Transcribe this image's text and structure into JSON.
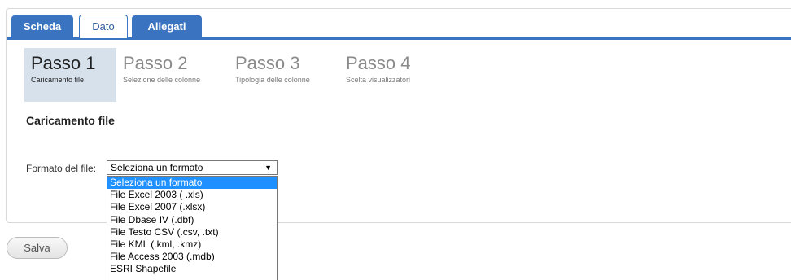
{
  "tabs": [
    {
      "label": "Scheda",
      "active": false
    },
    {
      "label": "Dato",
      "active": true
    },
    {
      "label": "Allegati",
      "active": false
    }
  ],
  "steps": [
    {
      "number": "Passo 1",
      "description": "Caricamento file",
      "active": true
    },
    {
      "number": "Passo 2",
      "description": "Selezione delle colonne",
      "active": false
    },
    {
      "number": "Passo 3",
      "description": "Tipologia delle colonne",
      "active": false
    },
    {
      "number": "Passo 4",
      "description": "Scelta visualizzatori",
      "active": false
    }
  ],
  "section_title": "Caricamento file",
  "format": {
    "label": "Formato del file:",
    "selected": "Seleziona un formato",
    "options": [
      "Seleziona un formato",
      "File Excel 2003 ( .xls)",
      "File Excel 2007 (.xlsx)",
      "File Dbase IV (.dbf)",
      "File Testo CSV (.csv, .txt)",
      "File KML (.kml, .kmz)",
      "File Access 2003 (.mdb)",
      "ESRI Shapefile"
    ],
    "highlighted_index": 0
  },
  "save_label": "Salva",
  "colors": {
    "tab_blue": "#3a73bf",
    "step_active_bg": "#d6e1ec",
    "option_highlight": "#1e90ff"
  }
}
